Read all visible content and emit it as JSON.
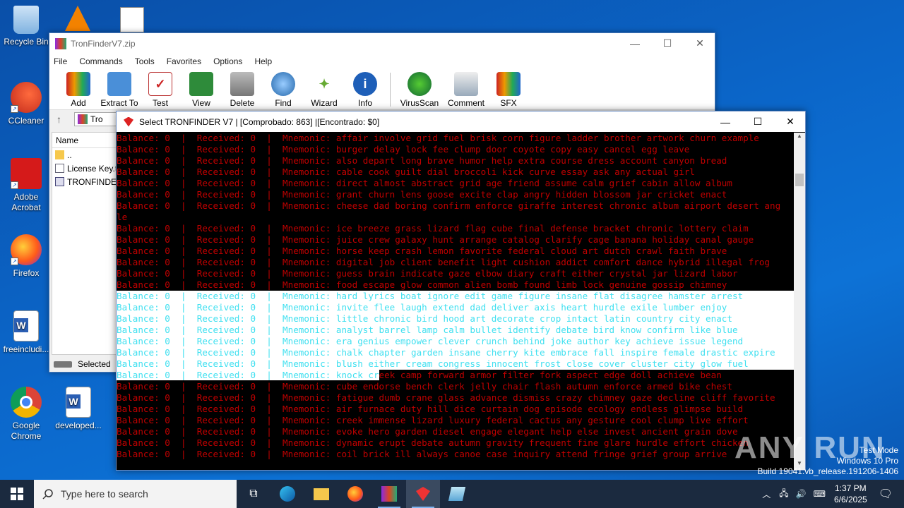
{
  "desktop": {
    "icons": [
      {
        "label": "Recycle Bin"
      },
      {
        "label": "CCleaner"
      },
      {
        "label": "Adobe Acrobat"
      },
      {
        "label": "Firefox"
      },
      {
        "label": "freeincludi..."
      },
      {
        "label": "Google Chrome"
      },
      {
        "label": "developed..."
      }
    ]
  },
  "winrar": {
    "title": "TronFinderV7.zip",
    "menu": [
      "File",
      "Commands",
      "Tools",
      "Favorites",
      "Options",
      "Help"
    ],
    "toolbar": [
      "Add",
      "Extract To",
      "Test",
      "View",
      "Delete",
      "Find",
      "Wizard",
      "Info",
      "VirusScan",
      "Comment",
      "SFX"
    ],
    "address": "Tro",
    "column_name": "Name",
    "files": [
      "..",
      "License Key.t",
      "TRONFINDER"
    ],
    "status": "Selected"
  },
  "console": {
    "title": "Select TRONFINDER V7 | [Comprobado: 863] |[Encontrado: $0]",
    "lines": [
      {
        "style": "red",
        "text": "Balance: 0  |  Received: 0  |  Mnemonic: affair involve grid fuel brisk corn figure ladder brother artwork churn example"
      },
      {
        "style": "red",
        "text": "Balance: 0  |  Received: 0  |  Mnemonic: burger delay lock fee clump door coyote copy easy cancel egg leave"
      },
      {
        "style": "red",
        "text": "Balance: 0  |  Received: 0  |  Mnemonic: also depart long brave humor help extra course dress account canyon bread"
      },
      {
        "style": "red",
        "text": "Balance: 0  |  Received: 0  |  Mnemonic: cable cook guilt dial broccoli kick curve essay ask any actual girl"
      },
      {
        "style": "red",
        "text": "Balance: 0  |  Received: 0  |  Mnemonic: direct almost abstract grid age friend assume calm grief cabin allow album"
      },
      {
        "style": "red",
        "text": "Balance: 0  |  Received: 0  |  Mnemonic: grant churn lens goose excite clap angry hidden blossom jar cricket enact"
      },
      {
        "style": "red",
        "text": "Balance: 0  |  Received: 0  |  Mnemonic: cheese dad boring confirm enforce giraffe interest chronic album airport desert ang"
      },
      {
        "style": "red",
        "text": "le"
      },
      {
        "style": "red",
        "text": "Balance: 0  |  Received: 0  |  Mnemonic: ice breeze grass lizard flag cube final defense bracket chronic lottery claim"
      },
      {
        "style": "red",
        "text": "Balance: 0  |  Received: 0  |  Mnemonic: juice crew galaxy hunt arrange catalog clarify cage banana holiday canal gauge"
      },
      {
        "style": "red",
        "text": "Balance: 0  |  Received: 0  |  Mnemonic: horse keep crash lemon favorite federal cloud art dutch crawl faith brave"
      },
      {
        "style": "red",
        "text": "Balance: 0  |  Received: 0  |  Mnemonic: digital job client benefit light cushion addict comfort dance hybrid illegal frog"
      },
      {
        "style": "red",
        "text": "Balance: 0  |  Received: 0  |  Mnemonic: guess brain indicate gaze elbow diary craft either crystal jar lizard labor"
      },
      {
        "style": "red",
        "text": "Balance: 0  |  Received: 0  |  Mnemonic: food escape glow common alien bomb found limb lock genuine gossip chimney"
      },
      {
        "style": "cyan",
        "text": "Balance: 0  |  Received: 0  |  Mnemonic: hard lyrics boat ignore edit game figure insane flat disagree hamster arrest"
      },
      {
        "style": "cyan",
        "text": "Balance: 0  |  Received: 0  |  Mnemonic: invite flee laugh extend dad deliver axis heart hurdle exile lumber enjoy"
      },
      {
        "style": "cyan",
        "text": "Balance: 0  |  Received: 0  |  Mnemonic: little chronic bird hood art decorate crop intact latin country city enact"
      },
      {
        "style": "cyan",
        "text": "Balance: 0  |  Received: 0  |  Mnemonic: analyst barrel lamp calm bullet identify debate bird know confirm like blue"
      },
      {
        "style": "cyan",
        "text": "Balance: 0  |  Received: 0  |  Mnemonic: era genius empower clever crunch behind joke author key achieve issue legend"
      },
      {
        "style": "cyan",
        "text": "Balance: 0  |  Received: 0  |  Mnemonic: chalk chapter garden insane cherry kite embrace fall inspire female drastic expire"
      },
      {
        "style": "cyan",
        "text": "Balance: 0  |  Received: 0  |  Mnemonic: blush either cream congress innocent frost close cover cluster city glow fuel"
      },
      {
        "style": "split",
        "text": "Balance: 0  |  Received: 0  |  Mnemonic: knock cr",
        "text2": "eek camp forward armor filter fork aspect edge doll achieve bean"
      },
      {
        "style": "red",
        "text": "Balance: 0  |  Received: 0  |  Mnemonic: cube endorse bench clerk jelly chair flash autumn enforce armed bike chest"
      },
      {
        "style": "red",
        "text": "Balance: 0  |  Received: 0  |  Mnemonic: fatigue dumb crane glass advance dismiss crazy chimney gaze decline cliff favorite"
      },
      {
        "style": "red",
        "text": "Balance: 0  |  Received: 0  |  Mnemonic: air furnace duty hill dice curtain dog episode ecology endless glimpse build"
      },
      {
        "style": "red",
        "text": "Balance: 0  |  Received: 0  |  Mnemonic: creek immense lizard luxury federal cactus any gesture cool clump live effort"
      },
      {
        "style": "red",
        "text": "Balance: 0  |  Received: 0  |  Mnemonic: evoke hero garden diesel engage elegant help else invest ancient grain dove"
      },
      {
        "style": "red",
        "text": "Balance: 0  |  Received: 0  |  Mnemonic: dynamic erupt debate autumn gravity frequent fine glare hurdle effort chicken"
      },
      {
        "style": "red",
        "text": "Balance: 0  |  Received: 0  |  Mnemonic: coil brick ill always canoe case inquiry attend fringe grief group arrive"
      }
    ]
  },
  "watermark": "ANY RUN",
  "os_info": {
    "line1": "Test Mode",
    "line2": "Windows 10 Pro",
    "line3": "Build 19041.vb_release.191206-1406"
  },
  "taskbar": {
    "search_placeholder": "Type here to search",
    "time": "1:37 PM",
    "date": "6/6/2025"
  },
  "colors": {
    "console_red": "#c00000",
    "console_cyan": "#40e0f0",
    "desktop": "#0b66c9"
  }
}
